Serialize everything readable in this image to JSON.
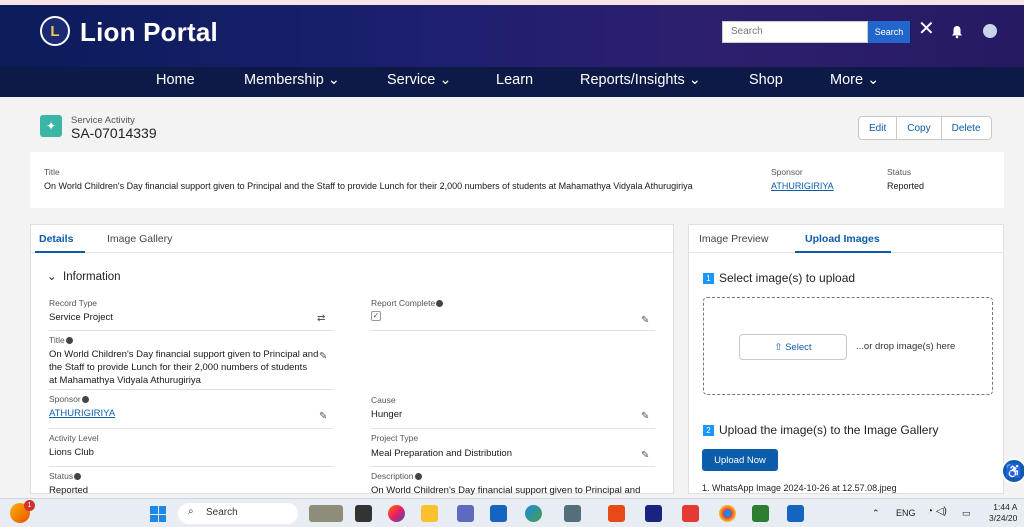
{
  "header": {
    "brand": "Lion Portal",
    "logo_text": "L",
    "search_placeholder": "Search",
    "search_button": "Search"
  },
  "nav": {
    "items": [
      "Home",
      "Membership ⌄",
      "Service ⌄",
      "Learn",
      "Reports/Insights ⌄",
      "Shop",
      "More ⌄"
    ]
  },
  "record": {
    "type_label": "Service Activity",
    "number": "SA-07014339",
    "actions": [
      "Edit",
      "Copy",
      "Delete"
    ]
  },
  "highlights": {
    "title_label": "Title",
    "title_value": "On World Children's Day financial support given to Principal and the Staff to provide Lunch for their 2,000 numbers of students at Mahamathya Vidyala Athurugiriya",
    "sponsor_label": "Sponsor",
    "sponsor_value": "ATHURIGIRIYA",
    "status_label": "Status",
    "status_value": "Reported"
  },
  "details": {
    "tabs": [
      "Details",
      "Image Gallery"
    ],
    "section": "Information",
    "fields": {
      "record_type_label": "Record Type",
      "record_type_value": "Service Project",
      "report_complete_label": "Report Complete",
      "title_label": "Title",
      "title_line1": "On World Children's Day financial support given to Principal and",
      "title_line2": "the Staff to provide Lunch for their 2,000 numbers of students",
      "title_line3": "at Mahamathya Vidyala Athurugiriya",
      "sponsor_label": "Sponsor",
      "sponsor_value": "ATHURIGIRIYA",
      "cause_label": "Cause",
      "cause_value": "Hunger",
      "activity_level_label": "Activity Level",
      "activity_level_value": "Lions Club",
      "project_type_label": "Project Type",
      "project_type_value": "Meal Preparation and Distribution",
      "status_label": "Status",
      "status_value": "Reported",
      "description_label": "Description",
      "description_value": "On World Children's Day financial support given to Principal and"
    }
  },
  "upload": {
    "tabs": [
      "Image Preview",
      "Upload Images"
    ],
    "step1_num": "1",
    "step1": "Select image(s) to upload",
    "select_button": "Select",
    "drop_text": "...or drop image(s) here",
    "step2_num": "2",
    "step2": "Upload the image(s) to the Image Gallery",
    "upload_button": "Upload Now",
    "file": "1. WhatsApp Image 2024-10-26 at 12.57.08.jpeg"
  },
  "taskbar": {
    "search": "Search",
    "lang": "ENG",
    "time": "1:44 A",
    "date": "3/24/20",
    "badge": "1"
  },
  "colors": {
    "accent": "#0b5cab",
    "header_bg": "#1c1f6f",
    "nav_bg": "#0d1a48",
    "record_icon": "#3bb5a6"
  }
}
